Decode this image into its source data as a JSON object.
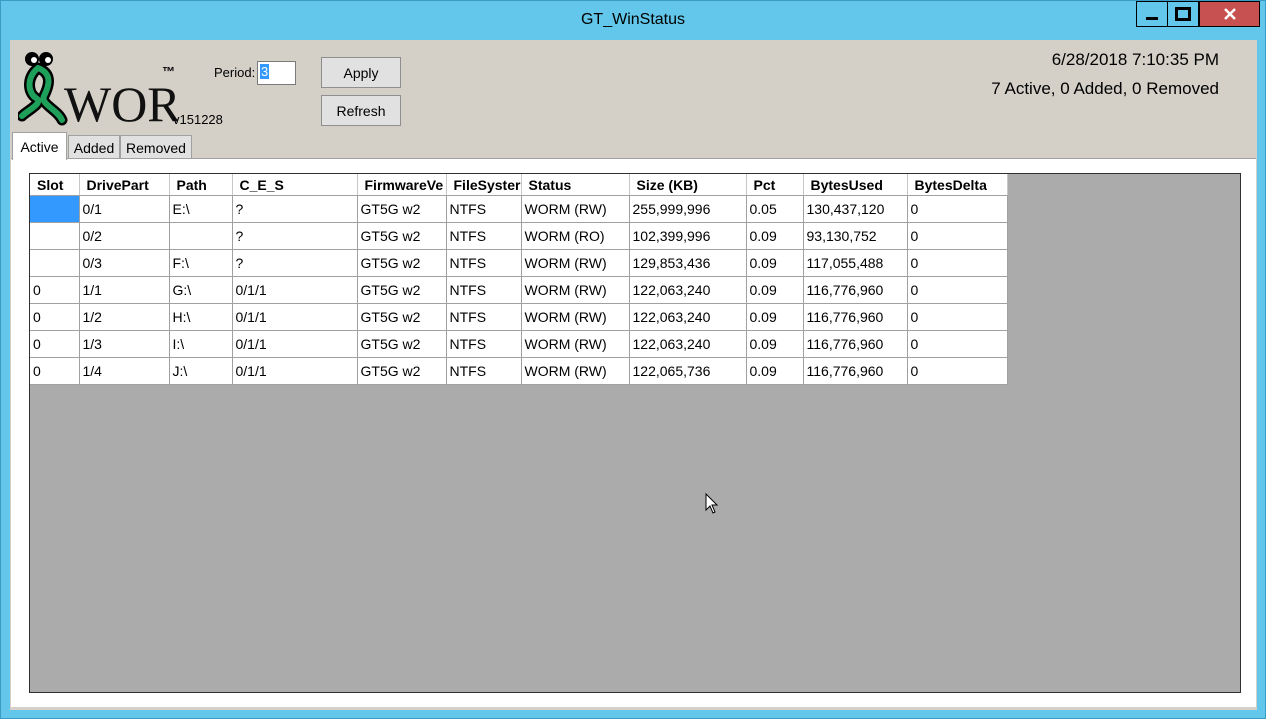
{
  "window": {
    "title": "GT_WinStatus"
  },
  "header": {
    "logo_text": "WORM",
    "trademark": "™",
    "version": "v151228",
    "period_label": "Period:",
    "period_value": "3",
    "apply_label": "Apply",
    "refresh_label": "Refresh",
    "datetime": "6/28/2018 7:10:35 PM",
    "counts": "7 Active, 0 Added, 0 Removed"
  },
  "tabs": [
    "Active",
    "Added",
    "Removed"
  ],
  "table": {
    "columns": [
      "Slot",
      "DrivePart",
      "Path",
      "C_E_S",
      "FirmwareVe",
      "FileSyster",
      "Status",
      "Size (KB)",
      "Pct",
      "BytesUsed",
      "BytesDelta"
    ],
    "rows": [
      [
        "",
        "0/1",
        "E:\\",
        "?",
        "GT5G w2",
        "NTFS",
        "WORM (RW)",
        "255,999,996",
        "0.05",
        "130,437,120",
        "0"
      ],
      [
        "",
        "0/2",
        "",
        "?",
        "GT5G w2",
        "NTFS",
        "WORM (RO)",
        "102,399,996",
        "0.09",
        "93,130,752",
        "0"
      ],
      [
        "",
        "0/3",
        "F:\\",
        "?",
        "GT5G w2",
        "NTFS",
        "WORM (RW)",
        "129,853,436",
        "0.09",
        "117,055,488",
        "0"
      ],
      [
        "0",
        "1/1",
        "G:\\",
        "0/1/1",
        "GT5G w2",
        "NTFS",
        "WORM (RW)",
        "122,063,240",
        "0.09",
        "116,776,960",
        "0"
      ],
      [
        "0",
        "1/2",
        "H:\\",
        "0/1/1",
        "GT5G w2",
        "NTFS",
        "WORM (RW)",
        "122,063,240",
        "0.09",
        "116,776,960",
        "0"
      ],
      [
        "0",
        "1/3",
        "I:\\",
        "0/1/1",
        "GT5G w2",
        "NTFS",
        "WORM (RW)",
        "122,063,240",
        "0.09",
        "116,776,960",
        "0"
      ],
      [
        "0",
        "1/4",
        "J:\\",
        "0/1/1",
        "GT5G w2",
        "NTFS",
        "WORM (RW)",
        "122,065,736",
        "0.09",
        "116,776,960",
        "0"
      ]
    ]
  },
  "colors": {
    "titlebar": "#62c7ea",
    "close_button": "#c75050",
    "selection": "#3399ff"
  }
}
